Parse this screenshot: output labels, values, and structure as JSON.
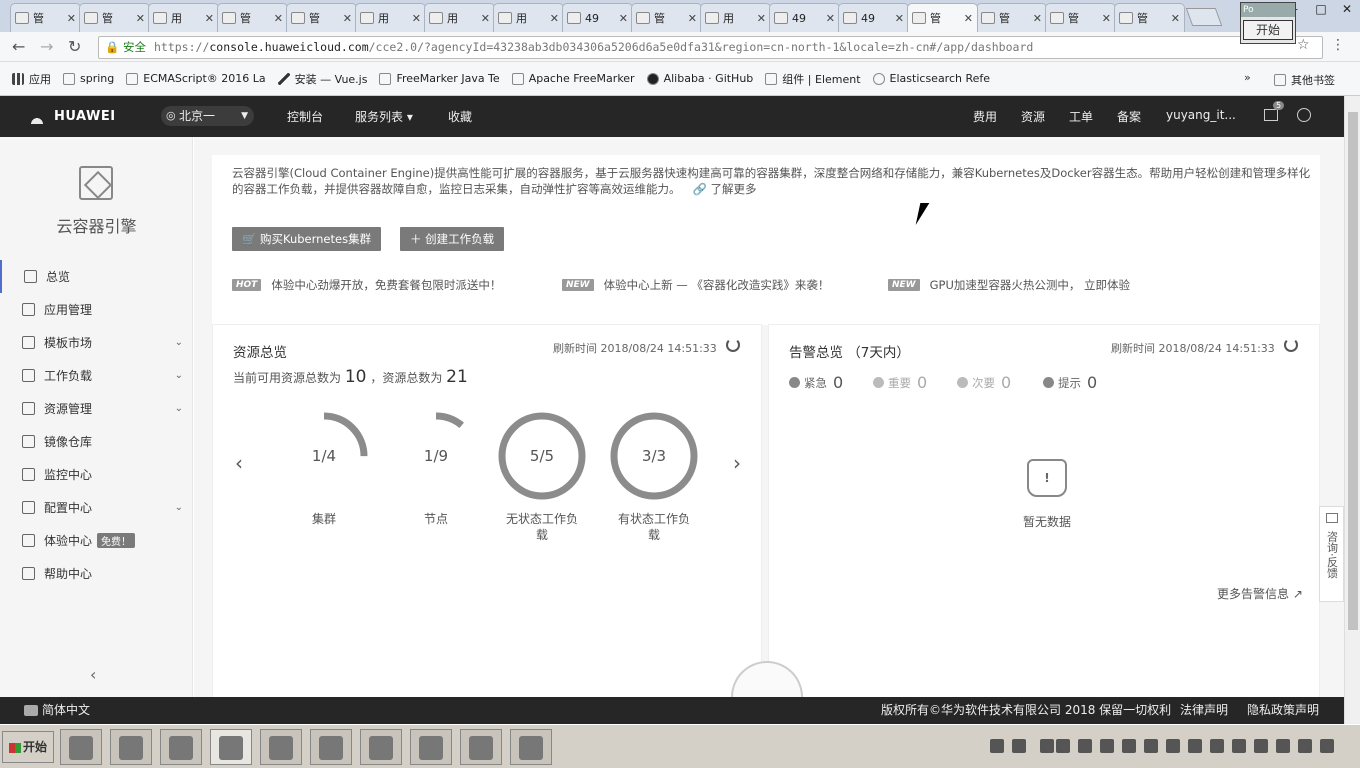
{
  "browser": {
    "tabs": [
      {
        "label": "管"
      },
      {
        "label": "管"
      },
      {
        "label": "用"
      },
      {
        "label": "管"
      },
      {
        "label": "管"
      },
      {
        "label": "用"
      },
      {
        "label": "用"
      },
      {
        "label": "用"
      },
      {
        "label": "49"
      },
      {
        "label": "管"
      },
      {
        "label": "用"
      },
      {
        "label": "49"
      },
      {
        "label": "49"
      },
      {
        "label": "管"
      },
      {
        "label": "管"
      },
      {
        "label": "管"
      },
      {
        "label": "管"
      }
    ],
    "popup_title": "Po",
    "popup_button": "开始",
    "secure_label": "安全",
    "url_scheme": "https://",
    "url_domain": "console.huaweicloud.com",
    "url_path": "/cce2.0/?agencyId=43238ab3db034306a5206d6a5e0dfa31&region=cn-north-1&locale=zh-cn#/app/dashboard",
    "bookmarks": [
      "应用",
      "spring",
      "ECMAScript® 2016 La",
      "安装 — Vue.js",
      "FreeMarker Java Te",
      "Apache FreeMarker",
      "Alibaba · GitHub",
      "组件 | Element",
      "Elasticsearch Refe"
    ],
    "bookmarks_more": "»",
    "other_bookmarks": "其他书签"
  },
  "header": {
    "brand": "HUAWEI",
    "region": "北京一",
    "nav": [
      "控制台",
      "服务列表 ▾",
      "收藏"
    ],
    "right": [
      "费用",
      "资源",
      "工单",
      "备案",
      "yuyang_it..."
    ],
    "msg_count": "5"
  },
  "sidebar": {
    "title": "云容器引擎",
    "items": [
      {
        "label": "总览",
        "chev": ""
      },
      {
        "label": "应用管理",
        "chev": ""
      },
      {
        "label": "模板市场",
        "chev": "⌄"
      },
      {
        "label": "工作负载",
        "chev": "⌄"
      },
      {
        "label": "资源管理",
        "chev": "⌄"
      },
      {
        "label": "镜像仓库",
        "chev": ""
      },
      {
        "label": "监控中心",
        "chev": ""
      },
      {
        "label": "配置中心",
        "chev": "⌄"
      },
      {
        "label": "体验中心",
        "chev": "",
        "badge": "免费！"
      },
      {
        "label": "帮助中心",
        "chev": ""
      }
    ],
    "collapse": "‹"
  },
  "intro": {
    "description": "云容器引擎(Cloud Container Engine)提供高性能可扩展的容器服务，基于云服务器快速构建高可靠的容器集群，深度整合网络和存储能力，兼容Kubernetes及Docker容器生态。帮助用户轻松创建和管理多样化的容器工作负载，并提供容器故障自愈，监控日志采集，自动弹性扩容等高效运维能力。",
    "more": "🔗 了解更多",
    "buy_button": "🛒 购买Kubernetes集群",
    "create_button": "＋ 创建工作负载",
    "news": [
      {
        "tag": "HOT",
        "text": "体验中心劲爆开放，免费套餐包限时派送中！"
      },
      {
        "tag": "NEW",
        "text": "体验中心上新 — 《容器化改造实践》来袭！"
      },
      {
        "tag": "NEW",
        "text": "GPU加速型容器火热公测中， 立即体验"
      }
    ]
  },
  "resources": {
    "title": "资源总览",
    "refresh_time": "刷新时间 2018/08/24 14:51:33",
    "summary_prefix": "当前可用资源总数为",
    "available": "10",
    "summary_mid": "，资源总数为",
    "total": "21",
    "gauges": [
      {
        "label": "集群",
        "value": "1/4",
        "fraction": 0.25
      },
      {
        "label": "节点",
        "value": "1/9",
        "fraction": 0.111
      },
      {
        "label": "无状态工作负载",
        "value": "5/5",
        "fraction": 1.0
      },
      {
        "label": "有状态工作负载",
        "value": "3/3",
        "fraction": 1.0
      }
    ],
    "prev": "‹",
    "next": "›"
  },
  "alarms": {
    "title": "告警总览 （7天内）",
    "refresh_time": "刷新时间 2018/08/24 14:51:33",
    "levels": [
      {
        "label": "紧急",
        "count": "0"
      },
      {
        "label": "重要",
        "count": "0"
      },
      {
        "label": "次要",
        "count": "0"
      },
      {
        "label": "提示",
        "count": "0"
      }
    ],
    "empty": "暂无数据",
    "more": "更多告警信息 ↗"
  },
  "feedback": "咨询·反馈",
  "footer": {
    "lang": "简体中文",
    "copyright": "版权所有©华为软件技术有限公司 2018 保留一切权利",
    "legal": "法律声明",
    "privacy": "隐私政策声明"
  },
  "taskbar": {
    "start": "开始"
  }
}
